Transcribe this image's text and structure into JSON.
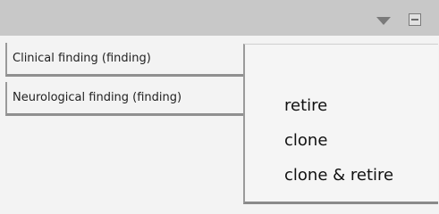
{
  "header": {
    "dropdown_icon": "triangle-down-icon",
    "collapse_icon": "minus-square-icon"
  },
  "list": {
    "items": [
      {
        "label": "Clinical finding (finding)"
      },
      {
        "label": "Neurological finding (finding)"
      }
    ]
  },
  "context_menu": {
    "items": [
      {
        "label": "retire"
      },
      {
        "label": "clone"
      },
      {
        "label": "clone & retire"
      }
    ]
  },
  "colors": {
    "titlebar": "#c8c8c8",
    "background": "#f3f3f3",
    "icon": "#7a7a7a"
  }
}
